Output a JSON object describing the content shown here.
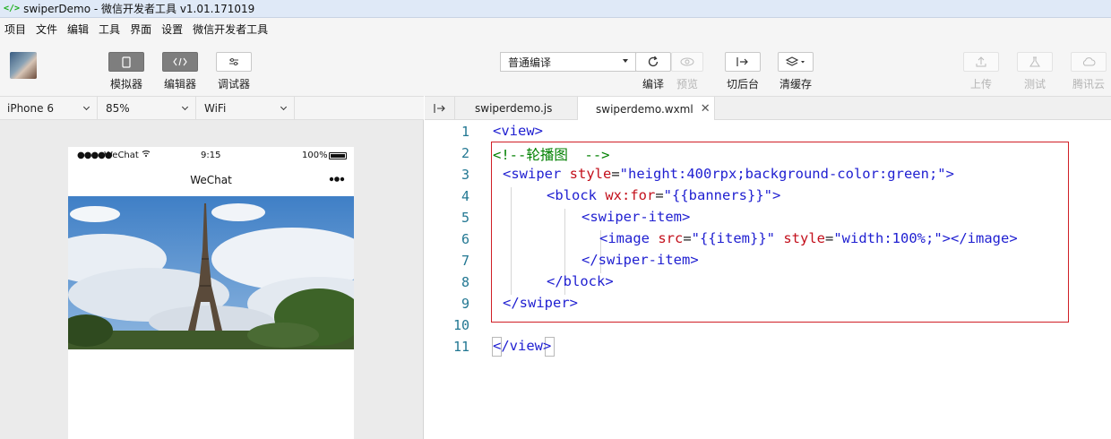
{
  "window": {
    "title": "swiperDemo - 微信开发者工具 v1.01.171019"
  },
  "menu": [
    "项目",
    "文件",
    "编辑",
    "工具",
    "界面",
    "设置",
    "微信开发者工具"
  ],
  "toolbar": {
    "simulator": "模拟器",
    "editor": "编辑器",
    "debugger": "调试器",
    "compile_mode": "普通编译",
    "compile": "编译",
    "preview": "预览",
    "background": "切后台",
    "clear_cache": "清缓存",
    "upload": "上传",
    "test": "测试",
    "tencent_cloud": "腾讯云"
  },
  "device": {
    "model": "iPhone 6",
    "zoom": "85%",
    "network": "WiFi"
  },
  "phone": {
    "signal": "●●●●●",
    "carrier": "WeChat",
    "time": "9:15",
    "battery": "100%",
    "nav_title": "WeChat"
  },
  "tabs": [
    {
      "label": "swiperdemo.js"
    },
    {
      "label": "swiperdemo.wxml"
    }
  ],
  "code": {
    "line_numbers": [
      "1",
      "2",
      "3",
      "4",
      "5",
      "6",
      "7",
      "8",
      "9",
      "10",
      "11"
    ],
    "l1": "<view>",
    "l2": "<!--轮播图  -->",
    "l3_open": "<swiper",
    "l3_attr": " style",
    "l3_eq": "=",
    "l3_val": "\"height:400rpx;background-color:green;\"",
    "l3_close": ">",
    "l4_open": "<block",
    "l4_attr": " wx:for",
    "l4_eq": "=",
    "l4_val": "\"{{banners}}\"",
    "l4_close": ">",
    "l5": "<swiper-item>",
    "l6_open": "<image",
    "l6_attr1": " src",
    "l6_eq1": "=",
    "l6_val1": "\"{{item}}\"",
    "l6_attr2": " style",
    "l6_eq2": "=",
    "l6_val2": "\"width:100%;\"",
    "l6_close": "></image>",
    "l7": "</swiper-item>",
    "l8": "</block>",
    "l9": "</swiper>",
    "l11": "</view>"
  }
}
